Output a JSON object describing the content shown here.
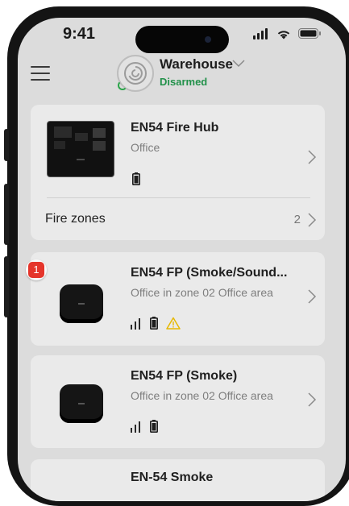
{
  "status_bar": {
    "time": "9:41"
  },
  "header": {
    "site_name": "Warehouse",
    "status": "Disarmed",
    "status_color": "#22914a"
  },
  "hub_card": {
    "title": "EN54 Fire Hub",
    "subtitle": "Office",
    "fire_zones_label": "Fire zones",
    "fire_zones_count": "2"
  },
  "devices": [
    {
      "title": "EN54 FP (Smoke/Sound...",
      "subtitle": "Office in zone 02 Office area",
      "badge": "1",
      "icons": [
        "signal-icon",
        "battery-icon",
        "warning-icon"
      ]
    },
    {
      "title": "EN54 FP (Smoke)",
      "subtitle": "Office in zone 02 Office area",
      "icons": [
        "signal-icon",
        "battery-icon"
      ]
    },
    {
      "title": "EN-54 Smoke"
    }
  ],
  "colors": {
    "badge": "#e5352b",
    "warning": "#e6b800",
    "card": "#eaeaea",
    "screen": "#dcdcdc"
  }
}
